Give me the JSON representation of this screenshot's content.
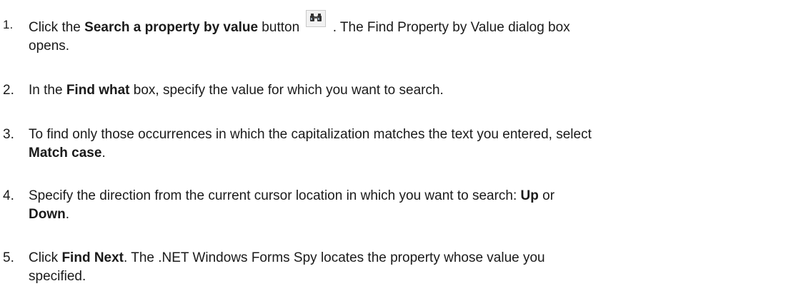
{
  "steps": [
    {
      "number": "1.",
      "t1": "Click the ",
      "b1": "Search a property by value",
      "t2": " button ",
      "icon": "binoculars-icon",
      "t3": " . The Find Property by Value dialog box",
      "line2": "opens."
    },
    {
      "number": "2.",
      "t1": "In the ",
      "b1": "Find what",
      "t2": " box, specify the value for which you want to search."
    },
    {
      "number": "3.",
      "t1": "To find only those occurrences in which the capitalization matches the text you entered, select",
      "b1": "Match case",
      "t2": "."
    },
    {
      "number": "4.",
      "t1": "Specify the direction from the current cursor location in which you want to search: ",
      "b1": "Up",
      "t2": " or",
      "b2": "Down",
      "t3": "."
    },
    {
      "number": "5.",
      "t1": "Click ",
      "b1": "Find Next",
      "t2": ". The .NET Windows Forms Spy locates the property whose value you",
      "line2": "specified."
    }
  ]
}
